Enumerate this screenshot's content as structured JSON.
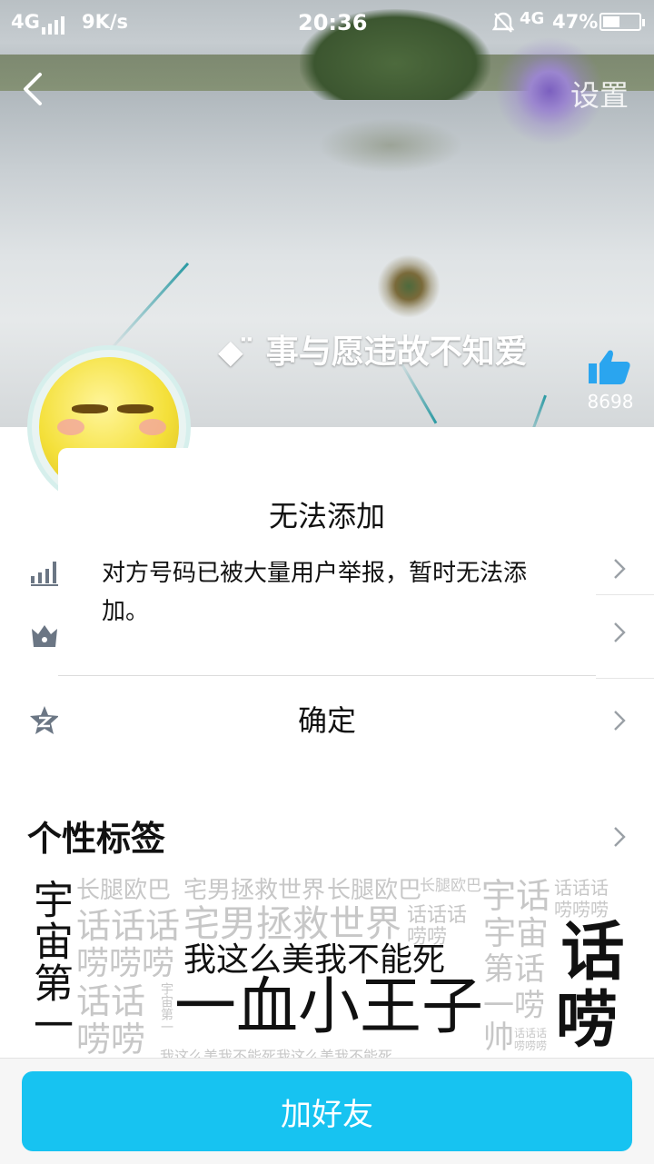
{
  "status_bar": {
    "network": "4G",
    "speed": "9K/s",
    "time": "20:36",
    "network_right": "4G",
    "battery": "47%",
    "battery_level": 0.47
  },
  "header": {
    "settings_label": "设置",
    "profile_name": "◆ ̈ 事与愿违故不知爱",
    "like_count": "8698"
  },
  "dialog": {
    "title": "无法添加",
    "message": "对方号码已被大量用户举报，暂时无法添加。",
    "confirm_label": "确定"
  },
  "profile": {
    "tags_title": "个性标签",
    "tag_cloud": [
      "宇宙第一",
      "长腿欧巴",
      "宅男拯救世界",
      "长腿欧巴",
      "长腿欧巴",
      "宇话",
      "话话话",
      "话话话",
      "宅男拯救世界",
      "话话话",
      "宇宙",
      "唠唠唠",
      "话",
      "唠唠唠",
      "我这么美我不能死",
      "唠唠",
      "第话",
      "话话",
      "宇宙第一",
      "一唠",
      "一血小王子",
      "唠",
      "唠唠",
      "帅",
      "话话话",
      "唠唠唠",
      "我这么美我不能死我这么美我不能死"
    ]
  },
  "colors": {
    "accent": "#17c3f1",
    "icon_gray": "#6b7684",
    "like_blue": "#2aa5ef"
  },
  "icons": {
    "back": "chevron-left-icon",
    "like": "thumbs-up-icon",
    "rank": "bar-chart-icon",
    "crown": "crown-icon",
    "zone": "star-z-icon",
    "chevron": "chevron-right-icon"
  },
  "bottom_bar": {
    "add_friend_label": "加好友"
  }
}
